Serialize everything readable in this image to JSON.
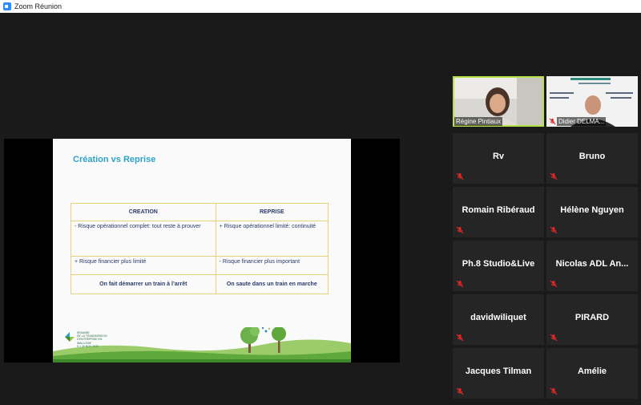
{
  "window": {
    "title": "Zoom Réunion"
  },
  "slide": {
    "title": "Création vs Reprise",
    "table": {
      "headers": [
        "CREATION",
        "REPRISE"
      ],
      "rows": [
        [
          "- Risque opérationnel complet: tout reste à prouver",
          "+ Risque opérationnel limité: continuité"
        ],
        [
          "+ Risque financier plus limité",
          "- Risque financier plus important"
        ],
        [
          "On fait démarrer un train à l’arrêt",
          "On saute dans un train en marche"
        ]
      ]
    },
    "footer_logo_text": "SEMAINE\nDE LA TRANSMISSION\nD'ENTREPRISE EN WALLONIE\n9 > 20 NOV 2020"
  },
  "video_participants": [
    {
      "name": "Régine Pintiaux",
      "active_speaker": true,
      "muted": false
    },
    {
      "name": "Didier DELMA...",
      "active_speaker": false,
      "muted": true
    }
  ],
  "participants": [
    {
      "name": "Rv",
      "muted": true
    },
    {
      "name": "Bruno",
      "muted": true
    },
    {
      "name": "Romain Ribéraud",
      "muted": true
    },
    {
      "name": "Hélène Nguyen",
      "muted": true
    },
    {
      "name": "Ph.8 Studio&Live",
      "muted": true
    },
    {
      "name": "Nicolas ADL An...",
      "muted": true
    },
    {
      "name": "davidwiliquet",
      "muted": true
    },
    {
      "name": "PIRARD",
      "muted": true
    },
    {
      "name": "Jacques Tilman",
      "muted": true
    },
    {
      "name": "Amélie",
      "muted": true
    }
  ],
  "colors": {
    "active_speaker_border": "#b8e04a",
    "mute_icon": "#e02828",
    "slide_title": "#2ea3c4",
    "table_border": "#e4d27a",
    "table_text": "#2a3b6b"
  },
  "icons": {
    "app": "zoom-logo-icon",
    "muted": "mic-muted-icon"
  }
}
